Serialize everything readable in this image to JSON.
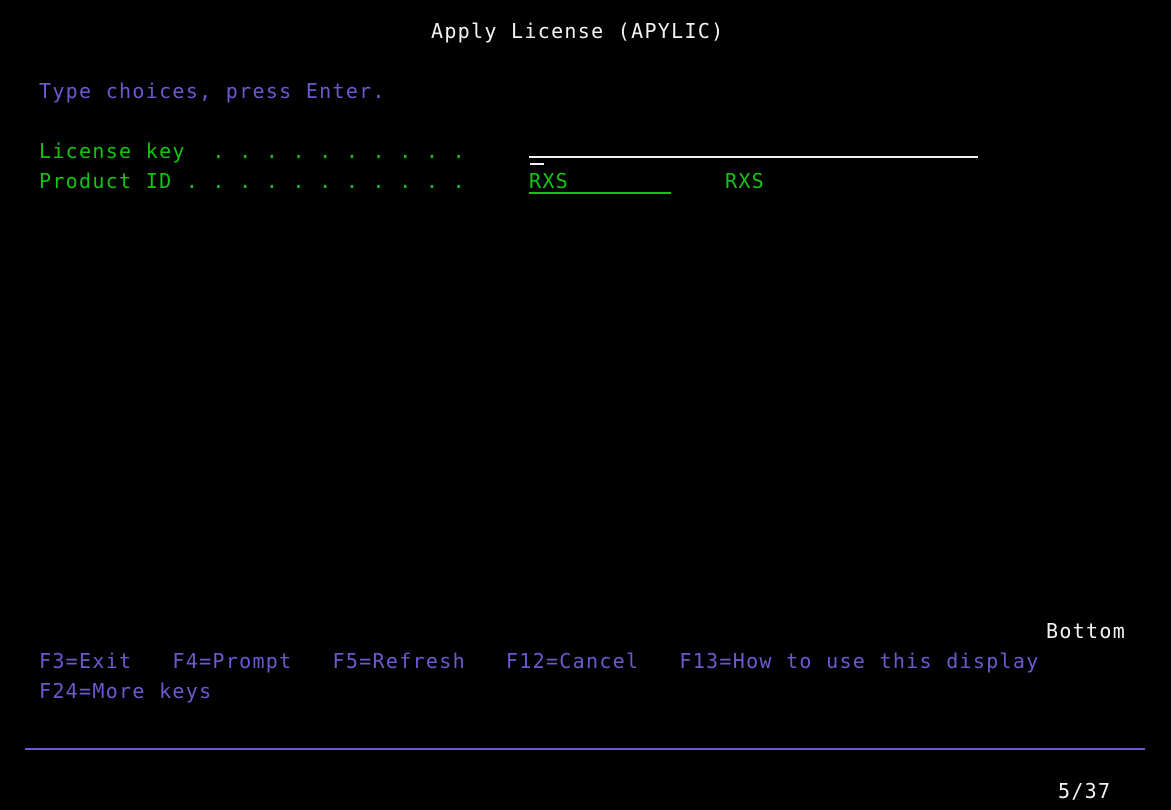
{
  "screen": {
    "title": "Apply License (APYLIC)",
    "instruction": "Type choices, press Enter.",
    "page_indicator": "Bottom",
    "status_position": "5/37"
  },
  "colors": {
    "background": "#000000",
    "title_text": "#f2f2f2",
    "prompt_text": "#6a5acd",
    "label_text": "#13c413",
    "input_text": "#13c413",
    "input_underline": "#f2f2f2",
    "separator": "#6a5acd"
  },
  "fields": [
    {
      "label": "License key  . . . . . . . . . .",
      "value": "",
      "placeholder": "",
      "echo": ""
    },
    {
      "label": "Product ID . . . . . . . . . . .",
      "value": "RXS",
      "placeholder": "",
      "echo": "RXS"
    }
  ],
  "function_keys": {
    "line1": "F3=Exit   F4=Prompt   F5=Refresh   F12=Cancel   F13=How to use this display",
    "line2": "F24=More keys",
    "items": [
      {
        "key": "F3",
        "label": "Exit"
      },
      {
        "key": "F4",
        "label": "Prompt"
      },
      {
        "key": "F5",
        "label": "Refresh"
      },
      {
        "key": "F12",
        "label": "Cancel"
      },
      {
        "key": "F13",
        "label": "How to use this display"
      },
      {
        "key": "F24",
        "label": "More keys"
      }
    ]
  }
}
